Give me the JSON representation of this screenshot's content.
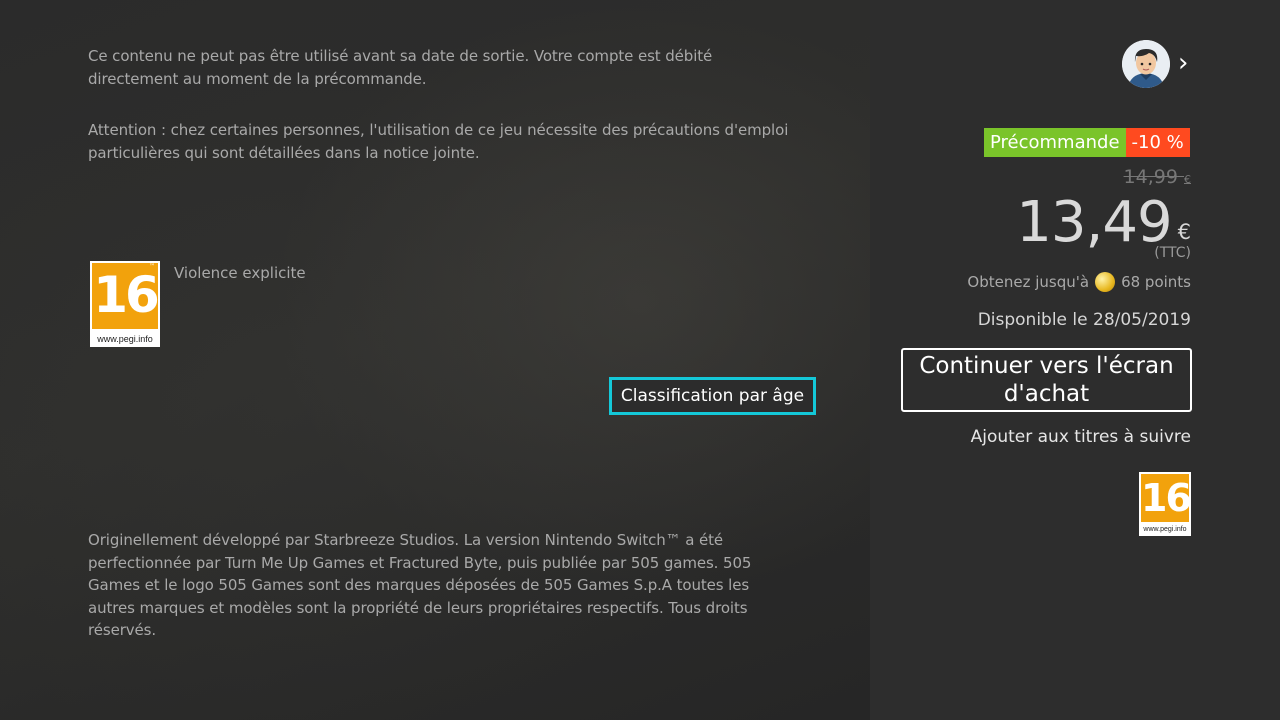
{
  "notices": {
    "preorder_notice": "Ce contenu ne peut pas être utilisé avant sa date de sortie. Votre compte est débité directement au moment de la précommande.",
    "health_warning": "Attention : chez certaines personnes, l'utilisation de ce jeu nécessite des précautions d'emploi particulières qui sont détaillées dans la notice jointe.",
    "legal_text": "Originellement développé par Starbreeze Studios. La version Nintendo Switch™ a été perfectionnée par Turn Me Up Games et Fractured Byte, puis publiée par 505 games. 505 Games et le logo 505 Games sont des marques déposées de 505 Games S.p.A toutes les autres marques et modèles sont la propriété de leurs propriétaires respectifs. Tous droits réservés."
  },
  "rating": {
    "pegi_number": "16",
    "pegi_tm": "™",
    "pegi_url": "www.pegi.info",
    "descriptor": "Violence explicite",
    "age_button_label": "Classification par âge"
  },
  "purchase": {
    "preorder_badge": "Précommande",
    "discount_badge": "-10 %",
    "old_price": "14,99",
    "old_currency": "€",
    "price": "13,49",
    "currency": "€",
    "tax_note": "(TTC)",
    "points_prefix": "Obtenez jusqu'à",
    "points_suffix": "68 points",
    "availability": "Disponible le 28/05/2019",
    "buy_button_label": "Continuer vers l'écran d'achat",
    "wishlist_label": "Ajouter aux titres à suivre"
  },
  "colors": {
    "focus_outline": "#14c8d8",
    "preorder_green": "#7ac42a",
    "discount_red": "#ff4a1f",
    "pegi_orange": "#f2a20c"
  },
  "icons": {
    "user": "user-avatar-icon",
    "chevron": "chevron-right-icon",
    "coin": "gold-points-coin-icon"
  }
}
